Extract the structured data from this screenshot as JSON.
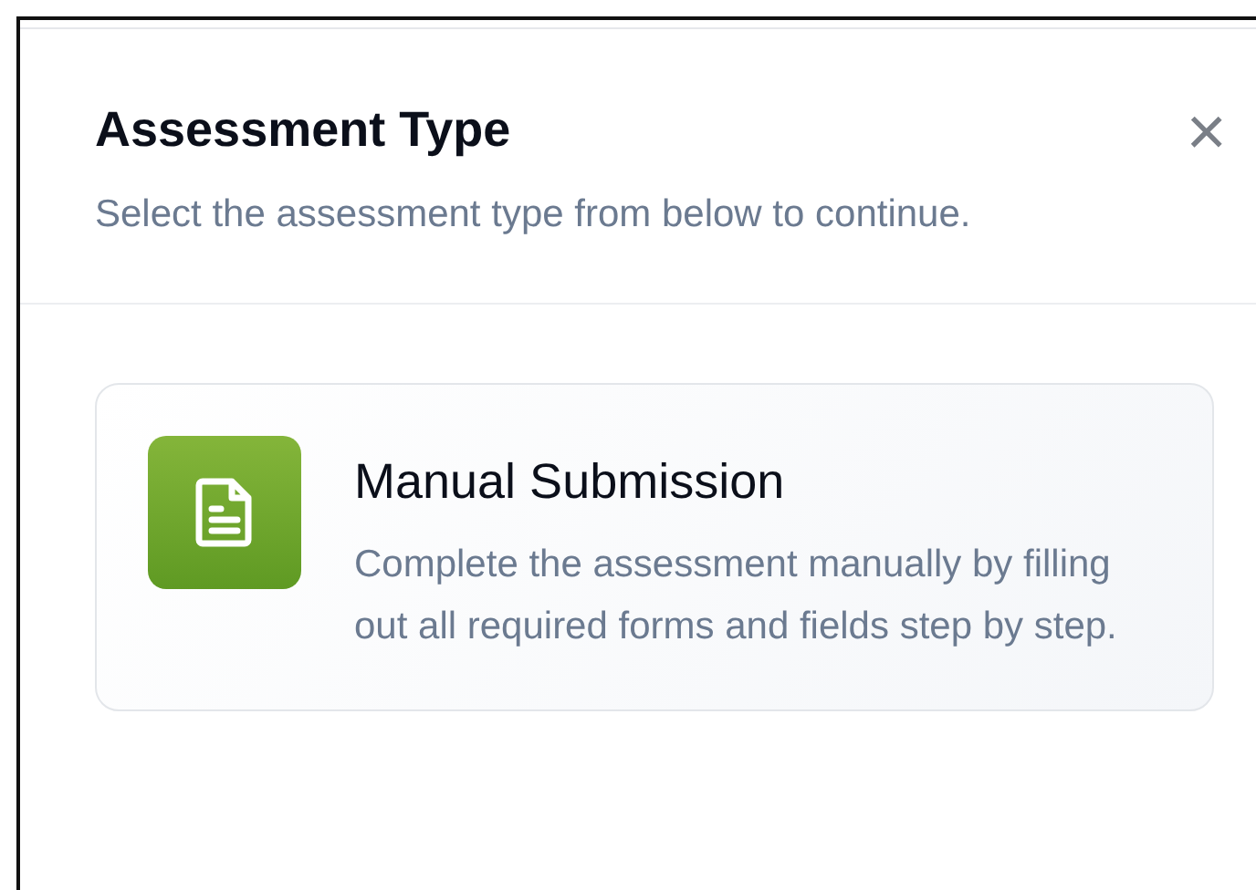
{
  "dialog": {
    "title": "Assessment Type",
    "subtitle": "Select the assessment type from below to continue.",
    "close_label": "×"
  },
  "options": [
    {
      "title": "Manual Submission",
      "description": "Complete the assessment manually by filling out all required forms and fields step by step."
    }
  ]
}
